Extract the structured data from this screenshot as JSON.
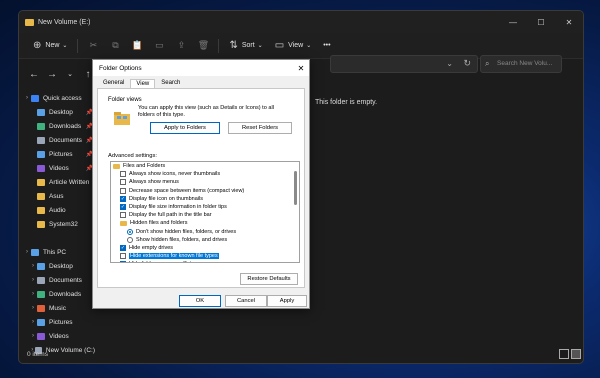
{
  "explorer": {
    "title": "New Volume (E:)",
    "toolbar": {
      "new_label": "New",
      "sort_label": "Sort",
      "view_label": "View",
      "more_label": "•••"
    },
    "search_placeholder": "Search New Volu...",
    "empty_message": "This folder is empty.",
    "status": "0 items",
    "sidebar": [
      {
        "label": "Quick access",
        "level": 0,
        "chev": "›",
        "color": "#3b82f6",
        "pin": ""
      },
      {
        "label": "Desktop",
        "level": 1,
        "chev": "",
        "color": "#5aa0e6",
        "pin": "📌"
      },
      {
        "label": "Downloads",
        "level": 1,
        "chev": "",
        "color": "#3fb27f",
        "pin": "📌"
      },
      {
        "label": "Documents",
        "level": 1,
        "chev": "",
        "color": "#9aa6b8",
        "pin": "📌"
      },
      {
        "label": "Pictures",
        "level": 1,
        "chev": "",
        "color": "#5aa0e6",
        "pin": "📌"
      },
      {
        "label": "Videos",
        "level": 1,
        "chev": "",
        "color": "#8a5ad6",
        "pin": "📌"
      },
      {
        "label": "Article Written",
        "level": 1,
        "chev": "",
        "color": "#e8b84a",
        "pin": ""
      },
      {
        "label": "Asus",
        "level": 1,
        "chev": "",
        "color": "#e8b84a",
        "pin": ""
      },
      {
        "label": "Audio",
        "level": 1,
        "chev": "",
        "color": "#e8b84a",
        "pin": ""
      },
      {
        "label": "System32",
        "level": 1,
        "chev": "",
        "color": "#e8b84a",
        "pin": ""
      },
      {
        "label": "",
        "level": 0,
        "chev": "",
        "color": "",
        "pin": ""
      },
      {
        "label": "This PC",
        "level": 0,
        "chev": "›",
        "color": "#5aa0e6",
        "pin": ""
      },
      {
        "label": "Desktop",
        "level": 1,
        "chev": "›",
        "color": "#5aa0e6",
        "pin": ""
      },
      {
        "label": "Documents",
        "level": 1,
        "chev": "›",
        "color": "#9aa6b8",
        "pin": ""
      },
      {
        "label": "Downloads",
        "level": 1,
        "chev": "›",
        "color": "#3fb27f",
        "pin": ""
      },
      {
        "label": "Music",
        "level": 1,
        "chev": "›",
        "color": "#e0603c",
        "pin": ""
      },
      {
        "label": "Pictures",
        "level": 1,
        "chev": "›",
        "color": "#5aa0e6",
        "pin": ""
      },
      {
        "label": "Videos",
        "level": 1,
        "chev": "›",
        "color": "#8a5ad6",
        "pin": ""
      },
      {
        "label": "New Volume (C:)",
        "level": 1,
        "chev": "›",
        "color": "#9aa6b8",
        "pin": ""
      }
    ]
  },
  "dialog": {
    "title": "Folder Options",
    "tabs": [
      "General",
      "View",
      "Search"
    ],
    "active_tab": "View",
    "folder_views_label": "Folder views",
    "folder_views_text": "You can apply this view (such as Details or Icons) to all folders of this type.",
    "apply_to_folders": "Apply to Folders",
    "reset_folders": "Reset Folders",
    "advanced_label": "Advanced settings:",
    "advanced_items": [
      {
        "kind": "folder",
        "label": "Files and Folders",
        "indent": 0,
        "checked": false,
        "selected": false
      },
      {
        "kind": "check",
        "label": "Always show icons, never thumbnails",
        "indent": 1,
        "checked": false,
        "selected": false
      },
      {
        "kind": "check",
        "label": "Always show menus",
        "indent": 1,
        "checked": false,
        "selected": false
      },
      {
        "kind": "check",
        "label": "Decrease space between items (compact view)",
        "indent": 1,
        "checked": false,
        "selected": false
      },
      {
        "kind": "check",
        "label": "Display file icon on thumbnails",
        "indent": 1,
        "checked": true,
        "selected": false
      },
      {
        "kind": "check",
        "label": "Display file size information in folder tips",
        "indent": 1,
        "checked": true,
        "selected": false
      },
      {
        "kind": "check",
        "label": "Display the full path in the title bar",
        "indent": 1,
        "checked": false,
        "selected": false
      },
      {
        "kind": "folder",
        "label": "Hidden files and folders",
        "indent": 1,
        "checked": false,
        "selected": false
      },
      {
        "kind": "radio",
        "label": "Don't show hidden files, folders, or drives",
        "indent": 2,
        "checked": true,
        "selected": false
      },
      {
        "kind": "radio",
        "label": "Show hidden files, folders, and drives",
        "indent": 2,
        "checked": false,
        "selected": false
      },
      {
        "kind": "check",
        "label": "Hide empty drives",
        "indent": 1,
        "checked": true,
        "selected": false
      },
      {
        "kind": "check",
        "label": "Hide extensions for known file types",
        "indent": 1,
        "checked": false,
        "selected": true
      },
      {
        "kind": "check",
        "label": "Hide folder merge conflicts",
        "indent": 1,
        "checked": true,
        "selected": false
      }
    ],
    "restore_defaults": "Restore Defaults",
    "ok": "OK",
    "cancel": "Cancel",
    "apply": "Apply"
  }
}
